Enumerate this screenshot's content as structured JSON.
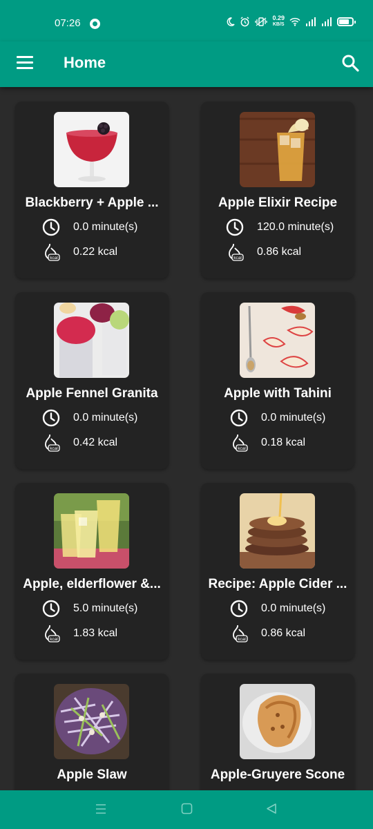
{
  "status_bar": {
    "time": "07:26",
    "net_speed_value": "0.29",
    "net_speed_unit": "KB/S",
    "icons": [
      "moon-icon",
      "alarm-icon",
      "vibrate-icon",
      "wifi-icon",
      "signal-icon",
      "signal-icon",
      "battery-icon"
    ]
  },
  "app_bar": {
    "title": "Home",
    "color": "#009b83"
  },
  "recipes": [
    {
      "title": "Blackberry + Apple ...",
      "time": "0.0 minute(s)",
      "kcal": "0.22 kcal"
    },
    {
      "title": "Apple Elixir Recipe",
      "time": "120.0 minute(s)",
      "kcal": "0.86 kcal"
    },
    {
      "title": "Apple Fennel Granita",
      "time": "0.0 minute(s)",
      "kcal": "0.42 kcal"
    },
    {
      "title": "Apple with Tahini",
      "time": "0.0 minute(s)",
      "kcal": "0.18 kcal"
    },
    {
      "title": "Apple, elderflower &...",
      "time": "5.0 minute(s)",
      "kcal": "1.83 kcal"
    },
    {
      "title": "Recipe: Apple Cider ...",
      "time": "0.0 minute(s)",
      "kcal": "0.86 kcal"
    },
    {
      "title": "Apple Slaw",
      "time": "",
      "kcal": ""
    },
    {
      "title": "Apple-Gruyere Scone",
      "time": "",
      "kcal": ""
    }
  ],
  "kcal_icon_label": "kcal",
  "nav": {
    "buttons": [
      "recents-icon",
      "home-icon",
      "back-icon"
    ]
  }
}
